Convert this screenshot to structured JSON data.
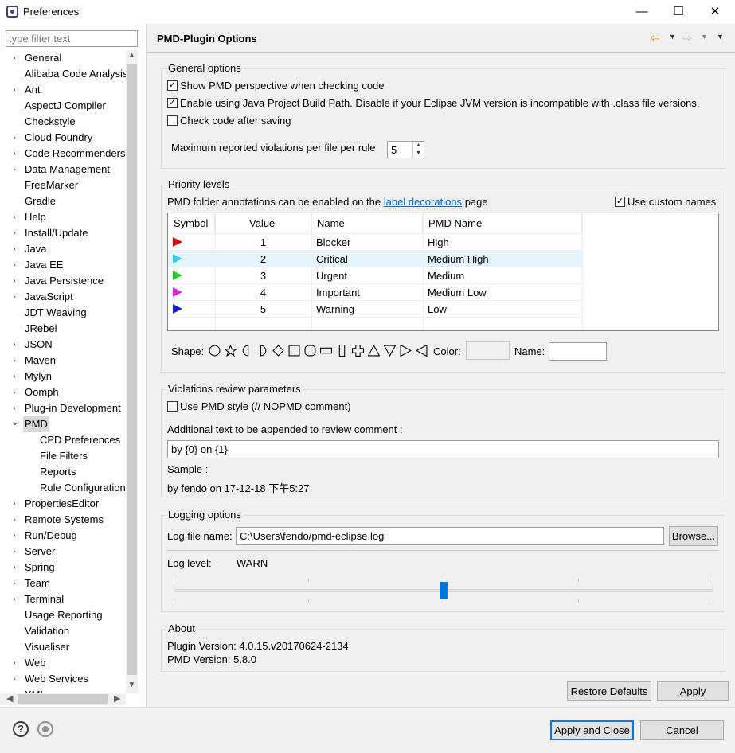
{
  "window": {
    "title": "Preferences",
    "minimize": "—",
    "maximize": "☐",
    "close": "✕"
  },
  "filter": {
    "placeholder": "type filter text"
  },
  "tree": {
    "items": [
      {
        "label": "General",
        "expandable": true
      },
      {
        "label": "Alibaba Code Analysis",
        "expandable": false
      },
      {
        "label": "Ant",
        "expandable": true
      },
      {
        "label": "AspectJ Compiler",
        "expandable": false
      },
      {
        "label": "Checkstyle",
        "expandable": false
      },
      {
        "label": "Cloud Foundry",
        "expandable": true
      },
      {
        "label": "Code Recommenders",
        "expandable": true
      },
      {
        "label": "Data Management",
        "expandable": true
      },
      {
        "label": "FreeMarker",
        "expandable": false
      },
      {
        "label": "Gradle",
        "expandable": false
      },
      {
        "label": "Help",
        "expandable": true
      },
      {
        "label": "Install/Update",
        "expandable": true
      },
      {
        "label": "Java",
        "expandable": true
      },
      {
        "label": "Java EE",
        "expandable": true
      },
      {
        "label": "Java Persistence",
        "expandable": true
      },
      {
        "label": "JavaScript",
        "expandable": true
      },
      {
        "label": "JDT Weaving",
        "expandable": false
      },
      {
        "label": "JRebel",
        "expandable": false
      },
      {
        "label": "JSON",
        "expandable": true
      },
      {
        "label": "Maven",
        "expandable": true
      },
      {
        "label": "Mylyn",
        "expandable": true
      },
      {
        "label": "Oomph",
        "expandable": true
      },
      {
        "label": "Plug-in Development",
        "expandable": true
      },
      {
        "label": "PMD",
        "expandable": true,
        "expanded": true,
        "selected": true
      },
      {
        "label": "CPD Preferences",
        "child": true
      },
      {
        "label": "File Filters",
        "child": true
      },
      {
        "label": "Reports",
        "child": true
      },
      {
        "label": "Rule Configuration",
        "child": true
      },
      {
        "label": "PropertiesEditor",
        "expandable": true
      },
      {
        "label": "Remote Systems",
        "expandable": true
      },
      {
        "label": "Run/Debug",
        "expandable": true
      },
      {
        "label": "Server",
        "expandable": true
      },
      {
        "label": "Spring",
        "expandable": true
      },
      {
        "label": "Team",
        "expandable": true
      },
      {
        "label": "Terminal",
        "expandable": true
      },
      {
        "label": "Usage Reporting",
        "expandable": false
      },
      {
        "label": "Validation",
        "expandable": false
      },
      {
        "label": "Visualiser",
        "expandable": false
      },
      {
        "label": "Web",
        "expandable": true
      },
      {
        "label": "Web Services",
        "expandable": true
      },
      {
        "label": "XML",
        "expandable": true
      }
    ]
  },
  "page": {
    "title": "PMD-Plugin Options"
  },
  "general": {
    "title": "General options",
    "show_perspective": {
      "label": "Show PMD perspective when checking code",
      "checked": true
    },
    "build_path": {
      "label": "Enable using Java Project Build Path.  Disable if your Eclipse JVM version is incompatible with .class file versions.",
      "checked": true
    },
    "check_on_save": {
      "label": "Check code after saving",
      "checked": false
    },
    "max_violations_label": "Maximum reported violations per file per rule",
    "max_violations_value": "5"
  },
  "priority": {
    "title": "Priority levels",
    "annotation_prefix": "PMD folder annotations can be enabled on the",
    "annotation_link": "label decorations",
    "annotation_suffix": "page",
    "use_custom_names": {
      "label": "Use custom names",
      "checked": true
    },
    "columns": [
      "Symbol",
      "Value",
      "Name",
      "PMD Name"
    ],
    "rows": [
      {
        "color": "#e00000",
        "value": "1",
        "name": "Blocker",
        "pmd_name": "High"
      },
      {
        "color": "#33ccee",
        "value": "2",
        "name": "Critical",
        "pmd_name": "Medium High"
      },
      {
        "color": "#22cc22",
        "value": "3",
        "name": "Urgent",
        "pmd_name": "Medium"
      },
      {
        "color": "#dd22dd",
        "value": "4",
        "name": "Important",
        "pmd_name": "Medium Low"
      },
      {
        "color": "#1a1acc",
        "value": "5",
        "name": "Warning",
        "pmd_name": "Low"
      }
    ],
    "shape_label": "Shape:",
    "color_label": "Color:",
    "name_label": "Name:",
    "shapes": [
      "circle-icon",
      "star-icon",
      "half-circle-left-icon",
      "half-circle-right-icon",
      "diamond-icon",
      "square-icon",
      "rounded-square-icon",
      "flat-rect-icon",
      "tall-rect-icon",
      "cross-icon",
      "triangle-up-icon",
      "triangle-down-icon",
      "triangle-right-icon",
      "triangle-left-icon"
    ]
  },
  "review": {
    "title": "Violations review parameters",
    "pmd_style": {
      "label": "Use PMD style (// NOPMD comment)",
      "checked": false
    },
    "additional_label": "Additional text to be appended to review comment :",
    "additional_value": "by {0} on {1}",
    "sample_label": "Sample :",
    "sample_value": "by fendo on 17-12-18 下午5:27"
  },
  "logging": {
    "title": "Logging options",
    "file_label": "Log file name:",
    "file_value": "C:\\Users\\fendo/pmd-eclipse.log",
    "browse": "Browse...",
    "level_label": "Log level:",
    "level_value": "WARN",
    "level_fraction": 0.5
  },
  "about": {
    "title": "About",
    "plugin_version": "Plugin Version: 4.0.15.v20170624-2134",
    "pmd_version": "PMD Version: 5.8.0"
  },
  "buttons": {
    "restore_defaults": "Restore Defaults",
    "apply": "Apply",
    "apply_and_close": "Apply and Close",
    "cancel": "Cancel"
  }
}
